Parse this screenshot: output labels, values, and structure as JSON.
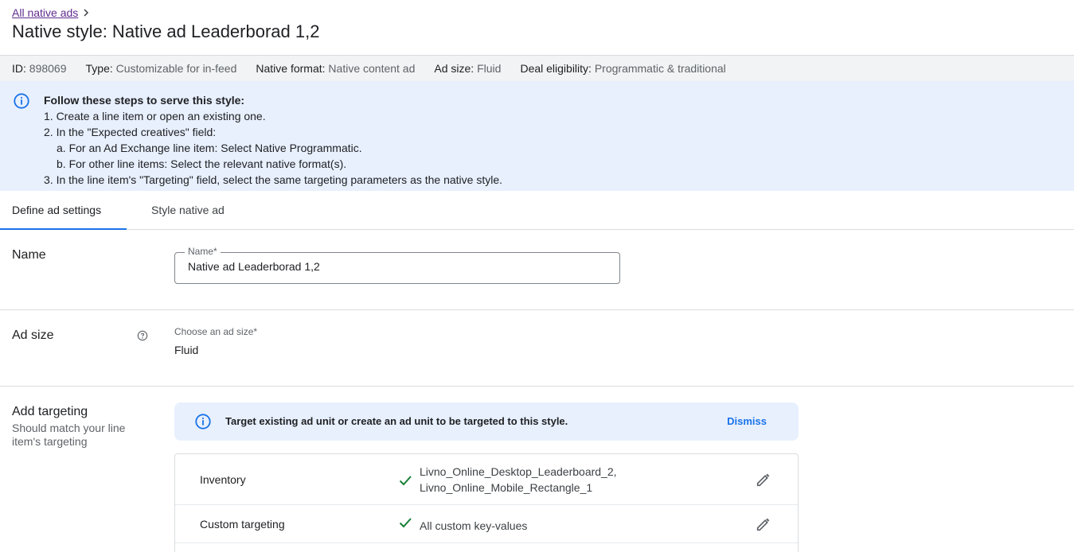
{
  "breadcrumb": {
    "link": "All native ads"
  },
  "page": {
    "title": "Native style: Native ad Leaderborad 1,2"
  },
  "meta": [
    {
      "key": "ID:",
      "value": "898069"
    },
    {
      "key": "Type:",
      "value": "Customizable for in-feed"
    },
    {
      "key": "Native format:",
      "value": "Native content ad"
    },
    {
      "key": "Ad size:",
      "value": "Fluid"
    },
    {
      "key": "Deal eligibility:",
      "value": "Programmatic & traditional"
    }
  ],
  "steps": {
    "title": "Follow these steps to serve this style:",
    "lines": [
      "1. Create a line item or open an existing one.",
      "2. In the \"Expected creatives\" field:",
      "a. For an Ad Exchange line item: Select Native Programmatic.",
      "b. For other line items: Select the relevant native format(s).",
      "3. In the line item's \"Targeting\" field, select the same targeting parameters as the native style."
    ]
  },
  "tabs": {
    "define": "Define ad settings",
    "style": "Style native ad"
  },
  "name_section": {
    "label": "Name",
    "field_label": "Name*",
    "value": "Native ad Leaderborad 1,2"
  },
  "adsize_section": {
    "label": "Ad size",
    "choose_label": "Choose an ad size*",
    "value": "Fluid"
  },
  "targeting_section": {
    "label": "Add targeting",
    "sub": "Should match your line item's targeting",
    "banner_msg": "Target existing ad unit or create an ad unit to be targeted to this style.",
    "dismiss": "Dismiss",
    "rows": [
      {
        "name": "Inventory",
        "value_1": "Livno_Online_Desktop_Leaderboard_2,",
        "value_2": "Livno_Online_Mobile_Rectangle_1"
      },
      {
        "name": "Custom targeting",
        "value_1": "All custom key-values"
      }
    ]
  },
  "colors": {
    "accent": "#1a73e8",
    "info_bg": "#e8f0fe",
    "check": "#188038",
    "link": "#5f2c8e"
  }
}
